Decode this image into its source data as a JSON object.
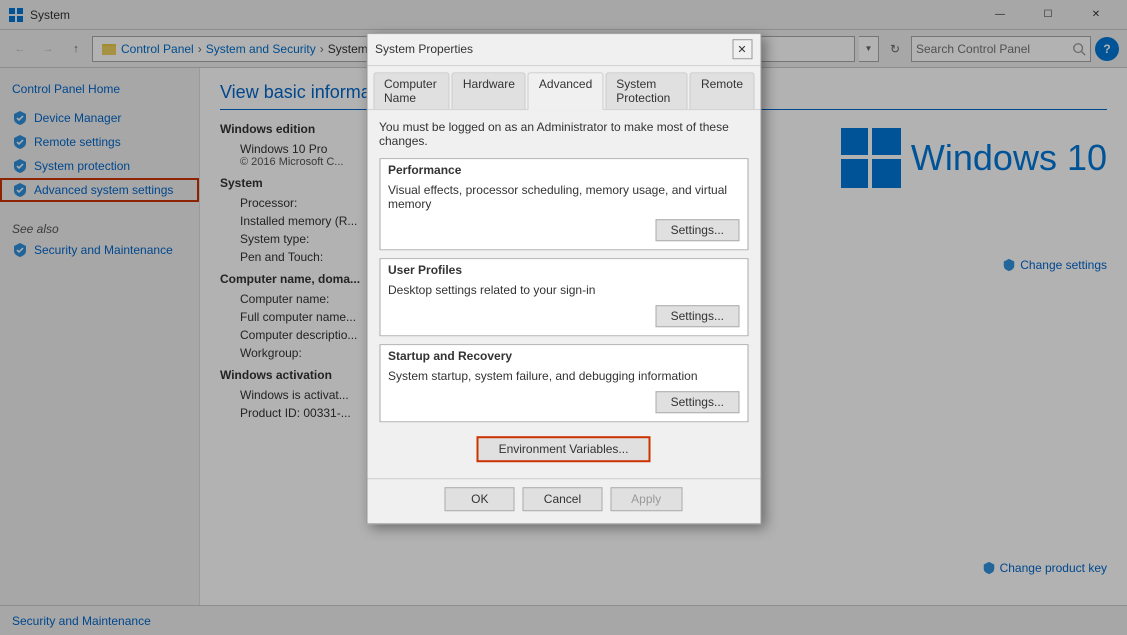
{
  "titlebar": {
    "app_name": "System",
    "min_label": "—",
    "max_label": "☐",
    "close_label": "✕"
  },
  "addressbar": {
    "search_placeholder": "Search Control Panel",
    "breadcrumbs": [
      "Control Panel",
      "System and Security",
      "System"
    ],
    "help_label": "?"
  },
  "sidebar": {
    "header": "Control Panel Home",
    "items": [
      {
        "label": "Device Manager",
        "icon": "shield"
      },
      {
        "label": "Remote settings",
        "icon": "shield"
      },
      {
        "label": "System protection",
        "icon": "shield"
      },
      {
        "label": "Advanced system settings",
        "icon": "shield",
        "active": true
      }
    ],
    "see_also_header": "See also",
    "see_also_link": "Security and Maintenance"
  },
  "page": {
    "title": "View basic information about your computer",
    "sections": {
      "windows_edition": {
        "header": "Windows edition",
        "edition": "Windows 10 Pro",
        "copyright": "© 2016 Microsoft C..."
      },
      "system": {
        "header": "System",
        "rows": [
          {
            "label": "Processor:",
            "value": ""
          },
          {
            "label": "Installed memory (R...",
            "value": ""
          },
          {
            "label": "System type:",
            "value": ""
          },
          {
            "label": "Pen and Touch:",
            "value": ""
          }
        ]
      },
      "computer_name": {
        "header": "Computer name, doma...",
        "rows": [
          {
            "label": "Computer name:",
            "value": ""
          },
          {
            "label": "Full computer name...",
            "value": ""
          },
          {
            "label": "Computer descriptio...",
            "value": ""
          },
          {
            "label": "Workgroup:",
            "value": ""
          }
        ]
      },
      "windows_activation": {
        "header": "Windows activation",
        "rows": [
          {
            "label": "Windows is activat...",
            "value": ""
          },
          {
            "label": "Product ID: 00331-...",
            "value": ""
          }
        ]
      }
    },
    "win10_logo_text": "Windows 10",
    "change_settings_label": "Change settings",
    "change_product_label": "Change product key"
  },
  "bottom_bar": {
    "link": "Security and Maintenance"
  },
  "dialog": {
    "title": "System Properties",
    "tabs": [
      {
        "label": "Computer Name",
        "active": false
      },
      {
        "label": "Hardware",
        "active": false
      },
      {
        "label": "Advanced",
        "active": true
      },
      {
        "label": "System Protection",
        "active": false
      },
      {
        "label": "Remote",
        "active": false
      }
    ],
    "note": "You must be logged on as an Administrator to make most of these changes.",
    "sections": [
      {
        "header": "Performance",
        "description": "Visual effects, processor scheduling, memory usage, and virtual memory",
        "btn_label": "Settings..."
      },
      {
        "header": "User Profiles",
        "description": "Desktop settings related to your sign-in",
        "btn_label": "Settings..."
      },
      {
        "header": "Startup and Recovery",
        "description": "System startup, system failure, and debugging information",
        "btn_label": "Settings..."
      }
    ],
    "env_var_btn": "Environment Variables...",
    "ok_label": "OK",
    "cancel_label": "Cancel",
    "apply_label": "Apply"
  }
}
